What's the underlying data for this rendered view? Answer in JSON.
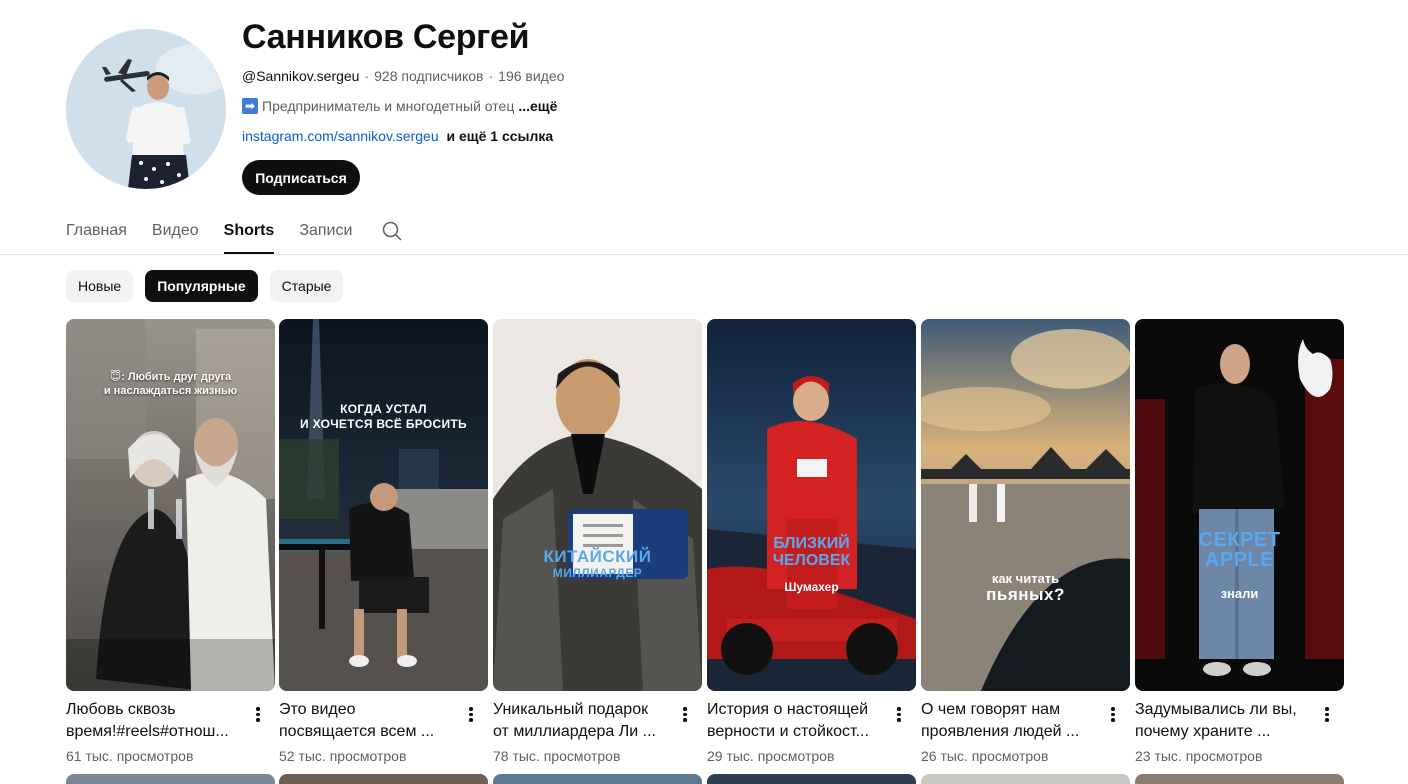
{
  "channel": {
    "name": "Санников Сергей",
    "handle": "@Sannikov.sergeu",
    "subscribers": "928 подписчиков",
    "videos": "196 видео",
    "meta_separator": "·",
    "description": "Предприниматель и многодетный отец",
    "description_icon": "arrow-right-emoji",
    "description_more": "...ещё",
    "link": "instagram.com/sannikov.sergeu",
    "more_links": "и ещё 1 ссылка",
    "subscribe_label": "Подписаться"
  },
  "tabs": [
    {
      "label": "Главная",
      "active": false
    },
    {
      "label": "Видео",
      "active": false
    },
    {
      "label": "Shorts",
      "active": true
    },
    {
      "label": "Записи",
      "active": false
    }
  ],
  "chips": [
    {
      "label": "Новые",
      "active": false
    },
    {
      "label": "Популярные",
      "active": true
    },
    {
      "label": "Старые",
      "active": false
    }
  ],
  "shorts": [
    {
      "title_line1": "Любовь сквозь",
      "title_line2": "время!#reels#отнош...",
      "views": "61 тыс. просмотров",
      "overlay": [
        "😇: Любить друг друга",
        "и наслаждаться жизнью"
      ]
    },
    {
      "title_line1": "Это видео",
      "title_line2": "посвящается всем ...",
      "views": "52 тыс. просмотров",
      "overlay": [
        "КОГДА УСТАЛ",
        "И ХОЧЕТСЯ ВСЁ БРОСИТЬ"
      ]
    },
    {
      "title_line1": "Уникальный подарок",
      "title_line2": "от миллиардера Ли ...",
      "views": "78 тыс. просмотров",
      "overlay": [
        "КИТАЙСКИЙ",
        "МИЛЛИАРДЕР"
      ]
    },
    {
      "title_line1": "История о настоящей",
      "title_line2": "верности и стойкост...",
      "views": "29 тыс. просмотров",
      "overlay": [
        "БЛИЗКИЙ",
        "ЧЕЛОВЕК",
        "Шумахер"
      ]
    },
    {
      "title_line1": "О чем говорят нам",
      "title_line2": "проявления людей ...",
      "views": "26 тыс. просмотров",
      "overlay": [
        "как читать",
        "пьяных?"
      ]
    },
    {
      "title_line1": "Задумывались ли вы,",
      "title_line2": "почему храните ...",
      "views": "23 тыс. просмотров",
      "overlay": [
        "СЕКРЕТ",
        "APPLE",
        "знали"
      ]
    }
  ],
  "colors": {
    "accent_link": "#065fd4",
    "overlay_blue": "#5aa9f0",
    "text_primary": "#0f0f0f",
    "text_secondary": "#606060"
  }
}
